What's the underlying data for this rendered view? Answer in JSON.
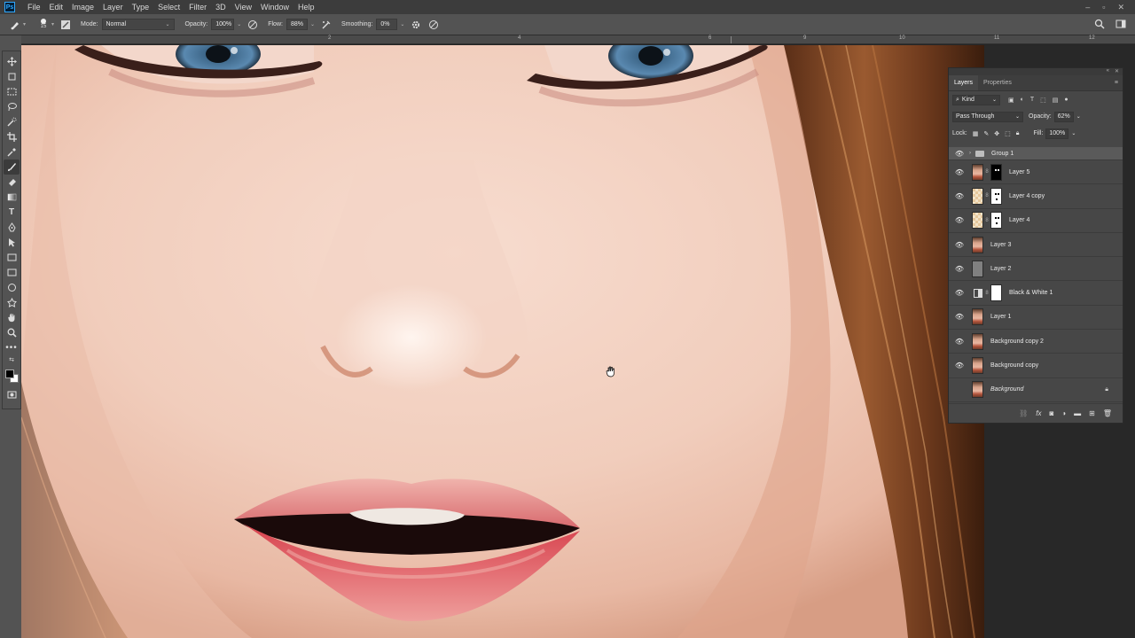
{
  "menubar": {
    "logo": "Ps",
    "items": [
      "File",
      "Edit",
      "Image",
      "Layer",
      "Type",
      "Select",
      "Filter",
      "3D",
      "View",
      "Window",
      "Help"
    ],
    "window_controls": [
      "–",
      "▫",
      "✕"
    ]
  },
  "options": {
    "brush_size": "15",
    "mode_label": "Mode:",
    "mode_value": "Normal",
    "opacity_label": "Opacity:",
    "opacity_value": "100%",
    "flow_label": "Flow:",
    "flow_value": "88%",
    "smoothing_label": "Smoothing:",
    "smoothing_value": "0%"
  },
  "ruler": {
    "labels": [
      "2",
      "4",
      "6",
      "8",
      "9",
      "10",
      "11",
      "12"
    ]
  },
  "layers_panel": {
    "tabs": [
      "Layers",
      "Properties"
    ],
    "filter_value": "Kind",
    "blend_mode": "Pass Through",
    "opacity_label": "Opacity:",
    "opacity_value": "62%",
    "lock_label": "Lock:",
    "fill_label": "Fill:",
    "fill_value": "100%",
    "layers": [
      {
        "name": "Group 1",
        "type": "group",
        "visible": true
      },
      {
        "name": "Layer 5",
        "type": "face-mask-black",
        "visible": true
      },
      {
        "name": "Layer 4 copy",
        "type": "skin-mask-white",
        "visible": true
      },
      {
        "name": "Layer 4",
        "type": "skin-mask-white",
        "visible": true
      },
      {
        "name": "Layer 3",
        "type": "face",
        "visible": true
      },
      {
        "name": "Layer 2",
        "type": "gray",
        "visible": true
      },
      {
        "name": "Black & White 1",
        "type": "adjustment",
        "visible": true
      },
      {
        "name": "Layer 1",
        "type": "face",
        "visible": true
      },
      {
        "name": "Background copy 2",
        "type": "face",
        "visible": true
      },
      {
        "name": "Background copy",
        "type": "face",
        "visible": true
      },
      {
        "name": "Background",
        "type": "background",
        "visible": false
      }
    ]
  },
  "colors": {
    "foreground": "#000000",
    "background": "#ffffff",
    "accent": "#31a8ff"
  }
}
